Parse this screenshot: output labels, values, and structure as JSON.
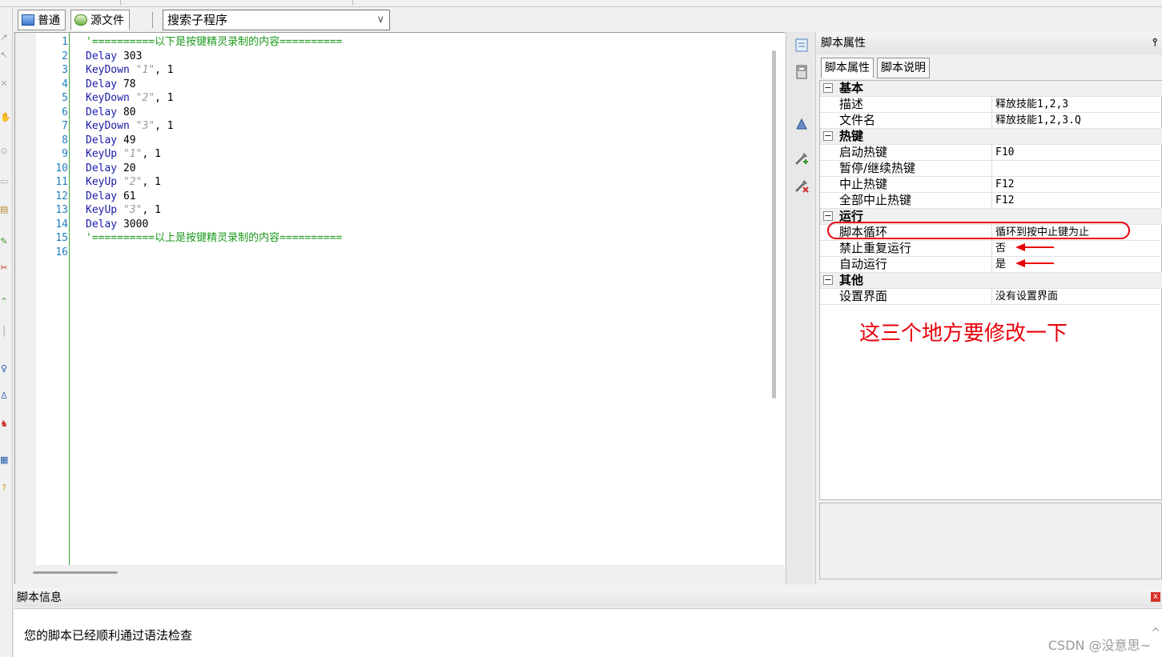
{
  "editor_tabs": [
    {
      "label": "普通",
      "icon": "normal-view-icon"
    },
    {
      "label": "源文件",
      "icon": "source-file-icon"
    }
  ],
  "subroutine_search": {
    "value": "搜索子程序"
  },
  "code": {
    "lines": [
      {
        "num": "1",
        "parts": [
          {
            "t": "cmt",
            "v": "'==========以下是按键精灵录制的内容=========="
          }
        ]
      },
      {
        "num": "2",
        "parts": [
          {
            "t": "kw",
            "v": "Delay"
          },
          {
            "t": "num",
            "v": " 303"
          }
        ]
      },
      {
        "num": "3",
        "parts": [
          {
            "t": "kw",
            "v": "KeyDown"
          },
          {
            "t": "str",
            "v": " \"1\""
          },
          {
            "t": "num",
            "v": ", 1"
          }
        ]
      },
      {
        "num": "4",
        "parts": [
          {
            "t": "kw",
            "v": "Delay"
          },
          {
            "t": "num",
            "v": " 78"
          }
        ]
      },
      {
        "num": "5",
        "parts": [
          {
            "t": "kw",
            "v": "KeyDown"
          },
          {
            "t": "str",
            "v": " \"2\""
          },
          {
            "t": "num",
            "v": ", 1"
          }
        ]
      },
      {
        "num": "6",
        "parts": [
          {
            "t": "kw",
            "v": "Delay"
          },
          {
            "t": "num",
            "v": " 80"
          }
        ]
      },
      {
        "num": "7",
        "parts": [
          {
            "t": "kw",
            "v": "KeyDown"
          },
          {
            "t": "str",
            "v": " \"3\""
          },
          {
            "t": "num",
            "v": ", 1"
          }
        ]
      },
      {
        "num": "8",
        "parts": [
          {
            "t": "kw",
            "v": "Delay"
          },
          {
            "t": "num",
            "v": " 49"
          }
        ]
      },
      {
        "num": "9",
        "parts": [
          {
            "t": "kw",
            "v": "KeyUp"
          },
          {
            "t": "str",
            "v": " \"1\""
          },
          {
            "t": "num",
            "v": ", 1"
          }
        ]
      },
      {
        "num": "10",
        "parts": [
          {
            "t": "kw",
            "v": "Delay"
          },
          {
            "t": "num",
            "v": " 20"
          }
        ]
      },
      {
        "num": "11",
        "parts": [
          {
            "t": "kw",
            "v": "KeyUp"
          },
          {
            "t": "str",
            "v": " \"2\""
          },
          {
            "t": "num",
            "v": ", 1"
          }
        ]
      },
      {
        "num": "12",
        "parts": [
          {
            "t": "kw",
            "v": "Delay"
          },
          {
            "t": "num",
            "v": " 61"
          }
        ]
      },
      {
        "num": "13",
        "parts": [
          {
            "t": "kw",
            "v": "KeyUp"
          },
          {
            "t": "str",
            "v": " \"3\""
          },
          {
            "t": "num",
            "v": ", 1"
          }
        ]
      },
      {
        "num": "14",
        "parts": [
          {
            "t": "kw",
            "v": "Delay"
          },
          {
            "t": "num",
            "v": " 3000"
          }
        ]
      },
      {
        "num": "15",
        "parts": [
          {
            "t": "cmt",
            "v": "'==========以上是按键精灵录制的内容=========="
          }
        ]
      },
      {
        "num": "16",
        "parts": []
      }
    ]
  },
  "midtools": [
    "note-icon",
    "calculator-icon",
    "pin-tool-icon",
    "add-tool-icon",
    "remove-tool-icon"
  ],
  "properties": {
    "header": "脚本属性",
    "pin": "⫯",
    "tabs": [
      {
        "label": "脚本属性"
      },
      {
        "label": "脚本说明"
      }
    ],
    "rows": [
      {
        "type": "cat",
        "name": "基本",
        "toggle": "−"
      },
      {
        "type": "prop",
        "name": "描述",
        "value": "释放技能1,2,3"
      },
      {
        "type": "prop",
        "name": "文件名",
        "value": "释放技能1,2,3.Q"
      },
      {
        "type": "cat",
        "name": "热键",
        "toggle": "−"
      },
      {
        "type": "prop",
        "name": "启动热键",
        "value": "F10"
      },
      {
        "type": "prop",
        "name": "暂停/继续热键",
        "value": ""
      },
      {
        "type": "prop",
        "name": "中止热键",
        "value": "F12"
      },
      {
        "type": "prop",
        "name": "全部中止热键",
        "value": "F12"
      },
      {
        "type": "cat",
        "name": "运行",
        "toggle": "−"
      },
      {
        "type": "prop",
        "name": "脚本循环",
        "value": "循环到按中止键为止"
      },
      {
        "type": "prop",
        "name": "禁止重复运行",
        "value": "否"
      },
      {
        "type": "prop",
        "name": "自动运行",
        "value": "是"
      },
      {
        "type": "cat",
        "name": "其他",
        "toggle": "−"
      },
      {
        "type": "prop",
        "name": "设置界面",
        "value": "没有设置界面"
      }
    ]
  },
  "annotation": {
    "text": "这三个地方要修改一下",
    "color": "#e8000b"
  },
  "info_panel": {
    "title": "脚本信息",
    "close": "x",
    "message": "您的脚本已经顺利通过语法检查",
    "watermark": "CSDN @没意思~",
    "scroll_up": "^"
  }
}
